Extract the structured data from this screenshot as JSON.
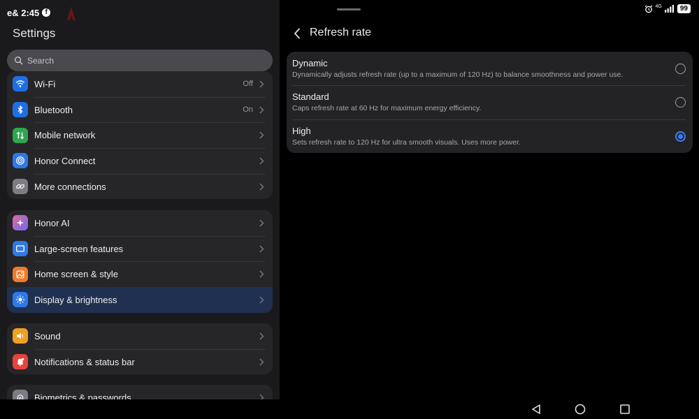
{
  "status_bar": {
    "carrier_time": "e& 2:45",
    "facebook_icon_letter": "f",
    "network_label": "4G",
    "battery": "99"
  },
  "settings": {
    "title": "Settings",
    "search_placeholder": "Search",
    "groups": [
      {
        "items": [
          {
            "label": "Wi-Fi",
            "value": "Off",
            "icon": "wifi-icon",
            "color": "#1e6fe6"
          },
          {
            "label": "Bluetooth",
            "value": "On",
            "icon": "bluetooth-icon",
            "color": "#1e6fe6"
          },
          {
            "label": "Mobile network",
            "value": "",
            "icon": "mobile-data-icon",
            "color": "#2ea54f"
          },
          {
            "label": "Honor Connect",
            "value": "",
            "icon": "honor-connect-icon",
            "color": "#2f78e8"
          },
          {
            "label": "More connections",
            "value": "",
            "icon": "link-icon",
            "color": "#7c7c84"
          }
        ]
      },
      {
        "items": [
          {
            "label": "Honor AI",
            "value": "",
            "icon": "sparkle-icon",
            "color": "#b05fd8"
          },
          {
            "label": "Large-screen features",
            "value": "",
            "icon": "large-screen-icon",
            "color": "#2f78e8"
          },
          {
            "label": "Home screen & style",
            "value": "",
            "icon": "image-icon",
            "color": "#f07a2c"
          },
          {
            "label": "Display & brightness",
            "value": "",
            "icon": "sun-icon",
            "color": "#2f78e8"
          }
        ]
      },
      {
        "items": [
          {
            "label": "Sound",
            "value": "",
            "icon": "speaker-icon",
            "color": "#f0a020"
          },
          {
            "label": "Notifications & status bar",
            "value": "",
            "icon": "bell-icon",
            "color": "#e8433c"
          }
        ]
      },
      {
        "items": [
          {
            "label": "Biometrics & passwords",
            "value": "",
            "icon": "fingerprint-icon",
            "color": "#7c7c84"
          }
        ]
      }
    ]
  },
  "refresh_rate": {
    "title": "Refresh rate",
    "options": [
      {
        "title": "Dynamic",
        "description": "Dynamically adjusts refresh rate (up to a maximum of 120 Hz) to balance smoothness and power use.",
        "selected": false
      },
      {
        "title": "Standard",
        "description": "Caps refresh rate at 60 Hz for maximum energy efficiency.",
        "selected": false
      },
      {
        "title": "High",
        "description": "Sets refresh rate to 120 Hz for ultra smooth visuals. Uses more power.",
        "selected": true
      }
    ]
  },
  "colors": {
    "accent": "#3f7ef2",
    "active_row": "#203050"
  }
}
